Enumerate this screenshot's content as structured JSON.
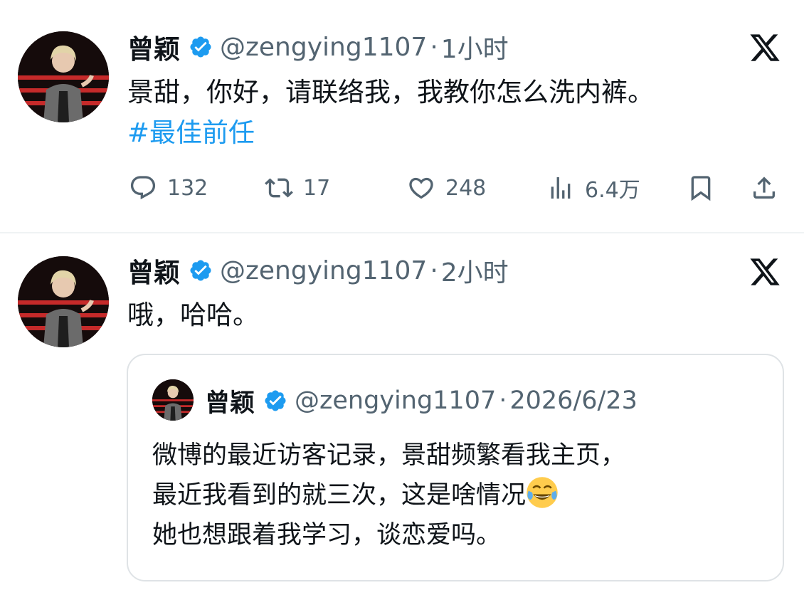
{
  "tweets": [
    {
      "author_name": "曾颖",
      "handle": "@zengying1107",
      "separator": "·",
      "time": "1小时",
      "text": "景甜，你好，请联络我，我教你怎么洗内裤。",
      "hashtag": "#最佳前任",
      "stats": {
        "replies": "132",
        "retweets": "17",
        "likes": "248",
        "views": "6.4万"
      }
    },
    {
      "author_name": "曾颖",
      "handle": "@zengying1107",
      "separator": "·",
      "time": "2小时",
      "text": "哦，哈哈。",
      "quoted": {
        "author_name": "曾颖",
        "handle": "@zengying1107",
        "separator": "·",
        "date": "2026/6/23",
        "lines": [
          "微博的最近访客记录，景甜频繁看我主页，",
          "最近我看到的就三次，这是啥情况",
          "她也想跟着我学习，谈恋爱吗。"
        ],
        "emoji": "face-with-tears-of-joy"
      }
    }
  ],
  "icons": {
    "verified": "verified-badge-icon",
    "platform": "x-logo-icon",
    "reply": "reply-icon",
    "retweet": "retweet-icon",
    "like": "heart-icon",
    "views": "views-icon",
    "bookmark": "bookmark-icon",
    "share": "share-icon"
  },
  "colors": {
    "verified": "#1d9bf0",
    "hashtag": "#1d9bf0",
    "secondary_text": "#536471",
    "primary_text": "#0f1419",
    "divider": "#eff3f4"
  }
}
